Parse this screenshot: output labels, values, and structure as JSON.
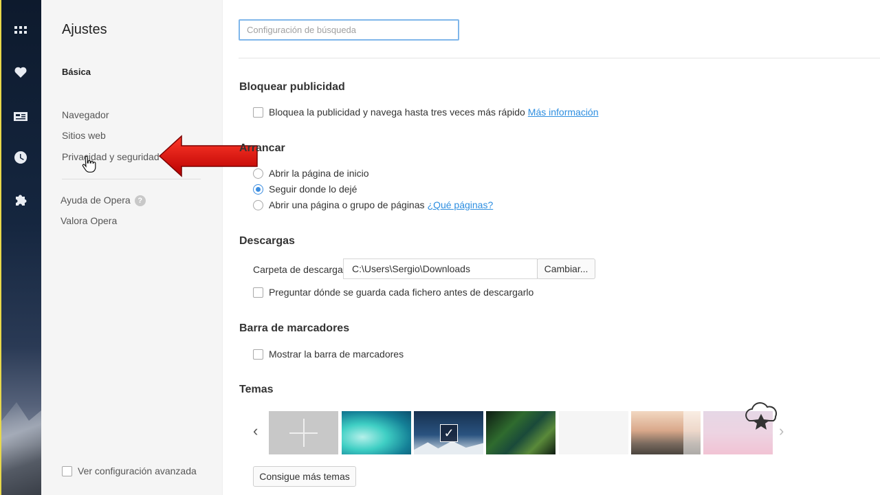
{
  "nav": {
    "title": "Ajustes",
    "section": "Básica",
    "items": [
      "Navegador",
      "Sitios web",
      "Privacidad y seguridad"
    ],
    "help_label": "Ayuda de Opera",
    "rate_label": "Valora Opera",
    "advanced_label": "Ver configuración avanzada"
  },
  "rail": {
    "icons": [
      "speed-dial-icon",
      "heart-icon",
      "news-icon",
      "history-clock-icon",
      "extensions-puzzle-icon"
    ]
  },
  "search": {
    "placeholder": "Configuración de búsqueda"
  },
  "adblock": {
    "heading": "Bloquear publicidad",
    "checkbox_label": "Bloquea la publicidad y navega hasta tres veces más rápido",
    "link": "Más información"
  },
  "startup": {
    "heading": "Arrancar",
    "options": [
      "Abrir la página de inicio",
      "Seguir donde lo dejé",
      "Abrir una página o grupo de páginas"
    ],
    "selected_index": 1,
    "link": "¿Qué páginas?"
  },
  "downloads": {
    "heading": "Descargas",
    "folder_label": "Carpeta de descarga:",
    "folder_path": "C:\\Users\\Sergio\\Downloads",
    "change_button": "Cambiar...",
    "ask_label": "Preguntar dónde se guarda cada fichero antes de descargarlo"
  },
  "bookmarks": {
    "heading": "Barra de marcadores",
    "show_label": "Mostrar la barra de marcadores"
  },
  "themes": {
    "heading": "Temas",
    "more_button": "Consigue más temas",
    "selected_index": 2
  },
  "colors": {
    "accent": "#3b8de0",
    "link": "#2d8ee0",
    "arrow": "#e00000"
  }
}
